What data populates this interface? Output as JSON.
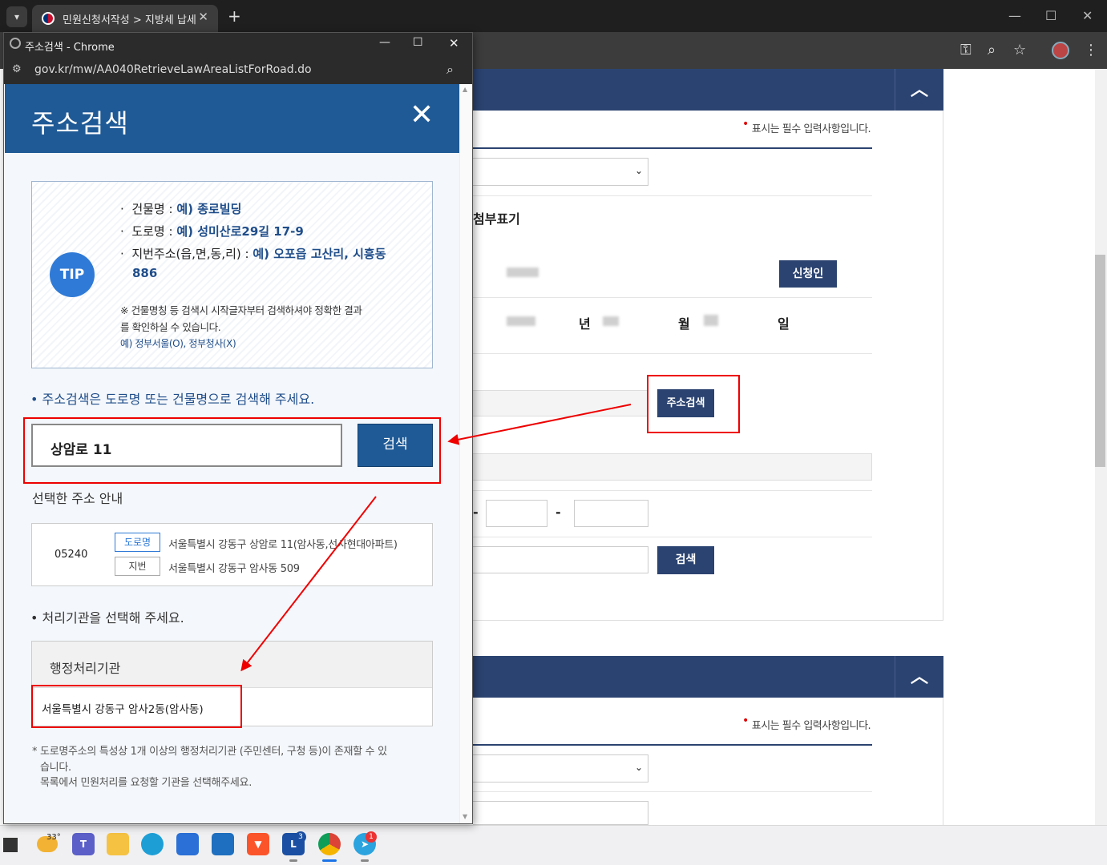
{
  "browser": {
    "tab_title": "민원신청서작성 > 지방세 납세",
    "window_title": "주소검색 - Chrome",
    "popup_url": "gov.kr/mw/AA040RetrieveLawAreaListForRoad.do"
  },
  "popup": {
    "header_title": "주소검색",
    "tip_badge": "TIP",
    "tips": [
      {
        "label": "건물명 : ",
        "example": "예) 종로빌딩"
      },
      {
        "label": "도로명 : ",
        "example": "예) 성미산로29길 17-9"
      },
      {
        "label": "지번주소(읍,면,동,리) : ",
        "example": "예) 오포읍 고산리, 시흥동"
      }
    ],
    "tip_example_cont": "886",
    "tip_note_line1": "※ 건물명칭 등 검색시 시작글자부터 검색하셔야 정확한 결과",
    "tip_note_line2": "를 확인하실 수 있습니다.",
    "tip_note_example": "예) 정부서울(O), 정부청사(X)",
    "search_guide": "주소검색은 도로명 또는 건물명으로 검색해 주세요.",
    "search_value": "상암로 11",
    "search_button": "검색",
    "selected_title": "선택한 주소 안내",
    "zipcode": "05240",
    "road_tag": "도로명",
    "road_address": "서울특별시 강동구 상암로 11(암사동,선사현대아파트)",
    "jibun_tag": "지번",
    "jibun_address": "서울특별시 강동구 암사동 509",
    "agency_guide": "처리기관을 선택해 주세요.",
    "agency_header": "행정처리기관",
    "agency_item": "서울특별시 강동구 암사2동(암사동)",
    "footnote_line1": "* 도로명주소의 특성상 1개 이상의 행정처리기관 (주민센터, 구청 등)이 존재할 수 있",
    "footnote_line2": "습니다.",
    "footnote_line3": "목록에서 민원처리를 요청할 기관을 선택해주세요."
  },
  "main": {
    "required_note": "표시는 필수 입력사항입니다.",
    "required_note2": "표시는 필수 입력사항입니다.",
    "attach_label": "첨부표기",
    "applicant_button": "신청인",
    "year_label": "년",
    "month_label": "월",
    "day_label": "일",
    "address_search_button": "주소검색",
    "search_button": "검색",
    "dash": "-"
  },
  "taskbar": {
    "weather": "33°",
    "badge_l": "3",
    "badge_telegram": "1"
  },
  "colors": {
    "navy": "#2b4370",
    "popup_header": "#1f5a96",
    "annotation_red": "#e00000"
  }
}
